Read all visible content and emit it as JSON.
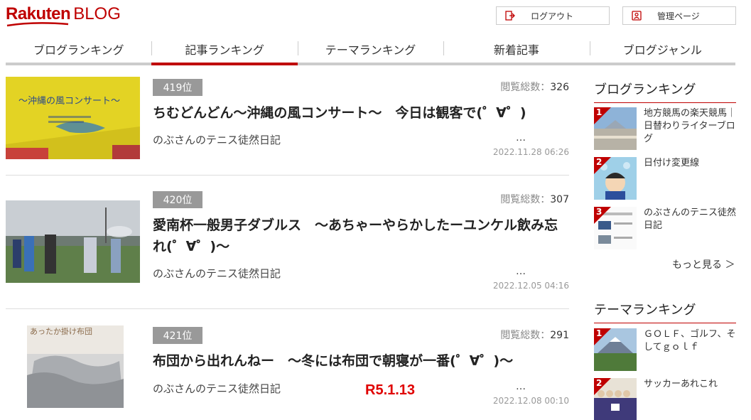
{
  "logo": {
    "brand": "Rakuten",
    "product": "BLOG"
  },
  "header": {
    "logout_label": "ログアウト",
    "admin_label": "管理ページ"
  },
  "tabs": [
    {
      "label": "ブログランキング"
    },
    {
      "label": "記事ランキング"
    },
    {
      "label": "テーマランキング"
    },
    {
      "label": "新着記事"
    },
    {
      "label": "ブログジャンル"
    }
  ],
  "views_label": "閲覧総数：",
  "articles": [
    {
      "rank": "419位",
      "views": "326",
      "title": "ちむどんどん～沖縄の風コンサート～　今日は観客で(゜∀゜)",
      "author": "のぶさんのテニス徒然日記",
      "ellipsis": "…",
      "date": "2022.11.28 06:26",
      "thumb_caption": "～沖縄の風コンサート～"
    },
    {
      "rank": "420位",
      "views": "307",
      "title": "愛南杯一般男子ダブルス　～あちゃーやらかしたーユンケル飲み忘れ(゜∀゜)～",
      "author": "のぶさんのテニス徒然日記",
      "ellipsis": "…",
      "date": "2022.12.05 04:16"
    },
    {
      "rank": "421位",
      "views": "291",
      "title": "布団から出れんねー　～冬には布団で朝寝が一番(゜∀゜)～",
      "author": "のぶさんのテニス徒然日記",
      "ellipsis": "…",
      "date": "2022.12.08 00:10",
      "overlay": "R5.1.13",
      "thumb_caption": "あったか掛け布団"
    }
  ],
  "sidebar": {
    "blog_ranking_title": "ブログランキング",
    "blog_ranking": [
      {
        "rank": "1",
        "name": "地方競馬の楽天競馬｜日替わりライターブログ"
      },
      {
        "rank": "2",
        "name": "日付け変更線"
      },
      {
        "rank": "3",
        "name": "のぶさんのテニス徒然日記"
      }
    ],
    "more_label": "もっと見る ＞",
    "theme_ranking_title": "テーマランキング",
    "theme_ranking": [
      {
        "rank": "1",
        "name": "ＧＯＬＦ、ゴルフ、そしてｇｏｌｆ"
      },
      {
        "rank": "2",
        "name": "サッカーあれこれ"
      }
    ]
  },
  "colors": {
    "brand_red": "#bf0000",
    "badge_gray": "#999999",
    "overlay_red": "#e00000"
  }
}
